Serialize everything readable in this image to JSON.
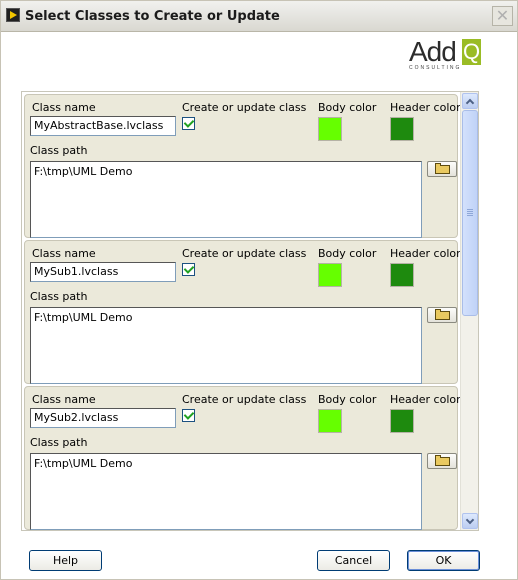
{
  "window": {
    "title": "Select Classes to Create or Update",
    "close_glyph": "✕"
  },
  "logo": {
    "main": "Add",
    "accent": "Q",
    "sub": "CONSULTING"
  },
  "labels": {
    "class_name": "Class name",
    "create_update": "Create or update class",
    "body_color": "Body color",
    "header_color": "Header color",
    "class_path": "Class path"
  },
  "classes": [
    {
      "name": "MyAbstractBase.lvclass",
      "create": true,
      "body_color": "#66ff00",
      "header_color": "#1e8a0e",
      "path": "F:\\tmp\\UML Demo"
    },
    {
      "name": "MySub1.lvclass",
      "create": true,
      "body_color": "#66ff00",
      "header_color": "#1e8a0e",
      "path": "F:\\tmp\\UML Demo"
    },
    {
      "name": "MySub2.lvclass",
      "create": true,
      "body_color": "#66ff00",
      "header_color": "#1e8a0e",
      "path": "F:\\tmp\\UML Demo"
    }
  ],
  "buttons": {
    "help": "Help",
    "cancel": "Cancel",
    "ok": "OK"
  }
}
